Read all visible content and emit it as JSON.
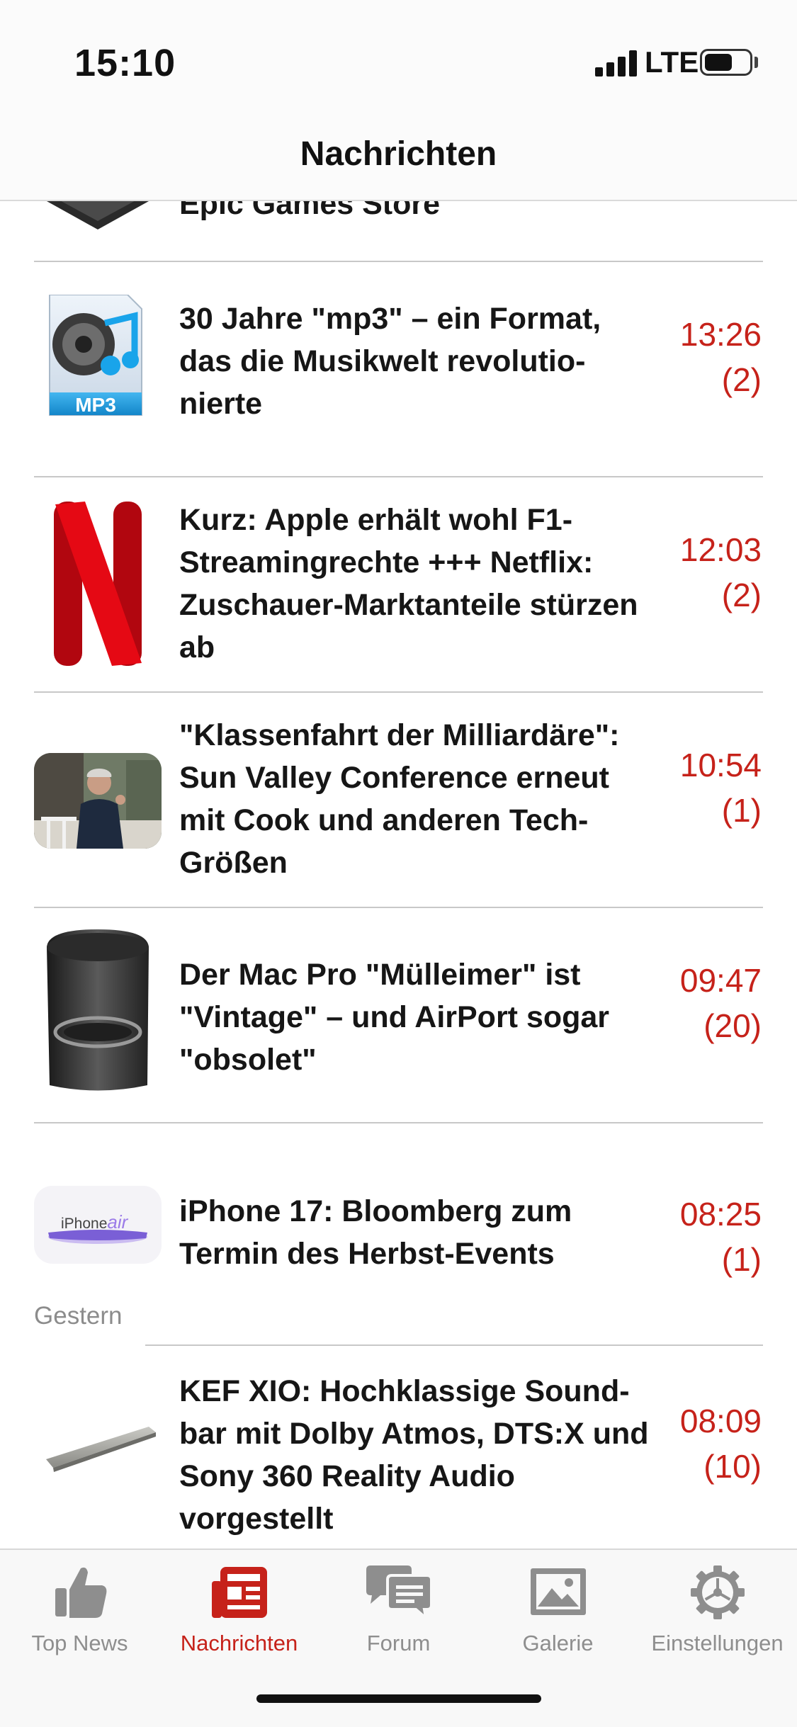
{
  "status_bar": {
    "time": "15:10",
    "network": "LTE",
    "icons": [
      "signal-bars-icon",
      "battery-icon"
    ]
  },
  "nav": {
    "title": "Nachrichten"
  },
  "colors": {
    "accent": "#c6221a",
    "tab_inactive": "#8e8e8e",
    "divider": "#c8c8c8"
  },
  "news": {
    "partial_item": {
      "title": "Epic Games Store"
    },
    "items": [
      {
        "thumb": "mp3-music-file-icon",
        "thumb_label": "MP3",
        "title": "30 Jahre \"mp3\" – ein Format, das die Musikwelt revolutio­nierte",
        "time": "13:26",
        "comments": "(2)"
      },
      {
        "thumb": "netflix-logo-icon",
        "title": "Kurz: Apple erhält wohl F1-Streamingrechte +++ Netflix: Zuschauer-Markt­anteile stürzen ab",
        "time": "12:03",
        "comments": "(2)"
      },
      {
        "thumb": "person-photo",
        "title": "\"Klassenfahrt der Milliardäre\": Sun Valley Conference erneut mit Cook und anderen Tech-Größen",
        "time": "10:54",
        "comments": "(1)"
      },
      {
        "thumb": "mac-pro-product-image",
        "title": "Der Mac Pro \"Mülleimer\" ist \"Vintage\" – und AirPort sogar \"obsolet\"",
        "time": "09:47",
        "comments": "(20)"
      },
      {
        "thumb": "iphone-air-image",
        "thumb_label": "iPhone",
        "thumb_label_2": "air",
        "title": "iPhone 17: Bloomberg zum Termin des Herbst-Events",
        "time": "08:25",
        "comments": "(1)"
      }
    ],
    "section_yesterday": "Gestern",
    "items_yesterday": [
      {
        "thumb": "soundbar-product-image",
        "title": "KEF XIO: Hochklassige Sound­bar mit Dolby Atmos, DTS:X und Sony 360 Reality Audio vorgestellt",
        "time": "08:09",
        "comments": "(10)"
      }
    ]
  },
  "tabs": [
    {
      "label": "Top News",
      "icon": "thumbs-up-icon",
      "active": false
    },
    {
      "label": "Nachrichten",
      "icon": "newspaper-icon",
      "active": true
    },
    {
      "label": "Forum",
      "icon": "chat-bubbles-icon",
      "active": false
    },
    {
      "label": "Galerie",
      "icon": "image-gallery-icon",
      "active": false
    },
    {
      "label": "Einstellungen",
      "icon": "gear-icon",
      "active": false
    }
  ]
}
